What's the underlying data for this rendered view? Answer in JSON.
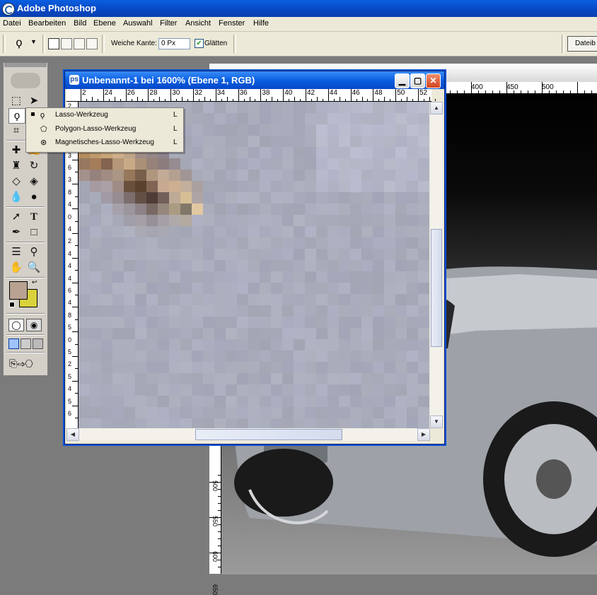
{
  "app": {
    "title": "Adobe Photoshop"
  },
  "menu": [
    "Datei",
    "Bearbeiten",
    "Bild",
    "Ebene",
    "Auswahl",
    "Filter",
    "Ansicht",
    "Fenster",
    "Hilfe"
  ],
  "options": {
    "feather_label": "Weiche Kante:",
    "feather_value": "0 Px",
    "smooth_label": "Glätten",
    "smooth_checked": true,
    "file_browser": "Dateib"
  },
  "document": {
    "title": "Unbenannt-1 bei 1600% (Ebene 1, RGB)",
    "hruler": [
      "2",
      "24",
      "26",
      "28",
      "30",
      "32",
      "34",
      "36",
      "38",
      "40",
      "42",
      "44",
      "46",
      "48",
      "50",
      "52"
    ],
    "vruler": [
      "2",
      "2",
      "3",
      "4",
      "3",
      "6",
      "3",
      "8",
      "4",
      "0",
      "4",
      "2",
      "4",
      "4",
      "4",
      "6",
      "4",
      "8",
      "5",
      "0",
      "5",
      "2",
      "5",
      "4",
      "5",
      "6"
    ]
  },
  "background_document": {
    "hruler": [
      "400",
      "450",
      "500"
    ],
    "vruler": [
      "500",
      "550",
      "600",
      "650"
    ]
  },
  "flyout": {
    "items": [
      {
        "label": "Lasso-Werkzeug",
        "key": "L",
        "icon": "lasso-icon",
        "selected": true
      },
      {
        "label": "Polygon-Lasso-Werkzeug",
        "key": "L",
        "icon": "polygon-lasso-icon",
        "selected": false
      },
      {
        "label": "Magnetisches-Lasso-Werkzeug",
        "key": "L",
        "icon": "magnetic-lasso-icon",
        "selected": false
      }
    ]
  },
  "colors": {
    "foreground": "#b8a292",
    "background": "#d9d23a",
    "title_active": "#0a5fe0",
    "canvas_base": "#a9acb8"
  },
  "toolbox": {
    "tools": [
      "marquee-icon",
      "move-icon",
      "lasso-icon",
      "magic-wand-icon",
      "crop-icon",
      "slice-icon",
      "healing-brush-icon",
      "brush-icon",
      "clone-stamp-icon",
      "history-brush-icon",
      "eraser-icon",
      "paint-bucket-icon",
      "blur-icon",
      "dodge-icon",
      "path-selection-icon",
      "type-icon",
      "pen-icon",
      "rectangle-icon",
      "notes-icon",
      "eyedropper-icon",
      "hand-icon",
      "zoom-icon"
    ]
  }
}
